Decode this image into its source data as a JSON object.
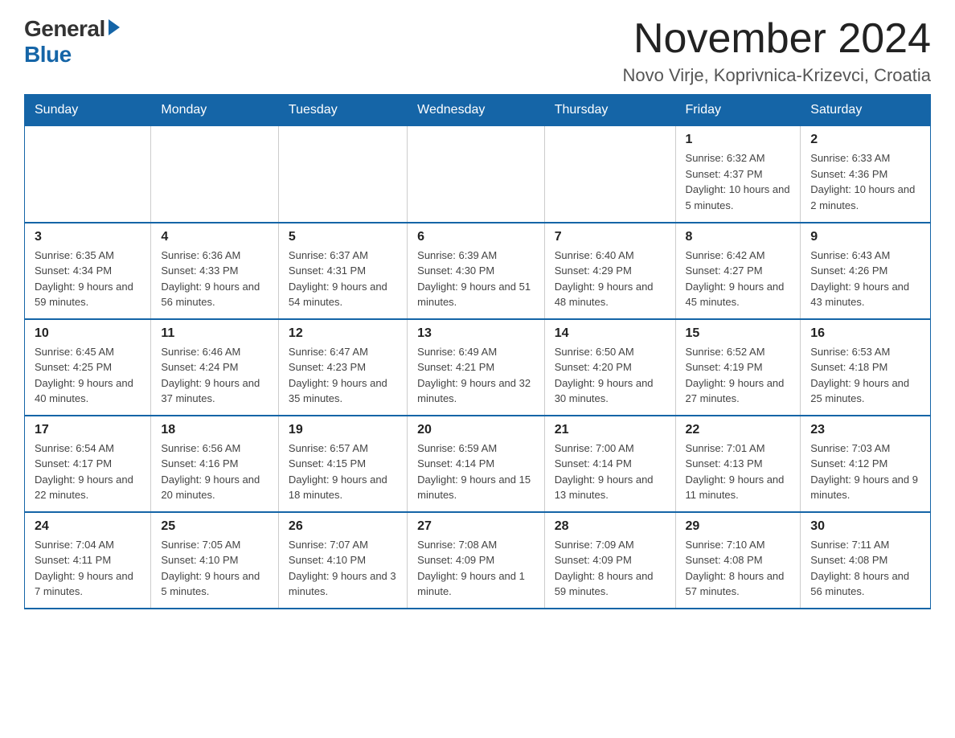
{
  "logo": {
    "general": "General",
    "blue": "Blue"
  },
  "title": "November 2024",
  "subtitle": "Novo Virje, Koprivnica-Krizevci, Croatia",
  "days_of_week": [
    "Sunday",
    "Monday",
    "Tuesday",
    "Wednesday",
    "Thursday",
    "Friday",
    "Saturday"
  ],
  "weeks": [
    [
      {
        "day": "",
        "info": ""
      },
      {
        "day": "",
        "info": ""
      },
      {
        "day": "",
        "info": ""
      },
      {
        "day": "",
        "info": ""
      },
      {
        "day": "",
        "info": ""
      },
      {
        "day": "1",
        "info": "Sunrise: 6:32 AM\nSunset: 4:37 PM\nDaylight: 10 hours and 5 minutes."
      },
      {
        "day": "2",
        "info": "Sunrise: 6:33 AM\nSunset: 4:36 PM\nDaylight: 10 hours and 2 minutes."
      }
    ],
    [
      {
        "day": "3",
        "info": "Sunrise: 6:35 AM\nSunset: 4:34 PM\nDaylight: 9 hours and 59 minutes."
      },
      {
        "day": "4",
        "info": "Sunrise: 6:36 AM\nSunset: 4:33 PM\nDaylight: 9 hours and 56 minutes."
      },
      {
        "day": "5",
        "info": "Sunrise: 6:37 AM\nSunset: 4:31 PM\nDaylight: 9 hours and 54 minutes."
      },
      {
        "day": "6",
        "info": "Sunrise: 6:39 AM\nSunset: 4:30 PM\nDaylight: 9 hours and 51 minutes."
      },
      {
        "day": "7",
        "info": "Sunrise: 6:40 AM\nSunset: 4:29 PM\nDaylight: 9 hours and 48 minutes."
      },
      {
        "day": "8",
        "info": "Sunrise: 6:42 AM\nSunset: 4:27 PM\nDaylight: 9 hours and 45 minutes."
      },
      {
        "day": "9",
        "info": "Sunrise: 6:43 AM\nSunset: 4:26 PM\nDaylight: 9 hours and 43 minutes."
      }
    ],
    [
      {
        "day": "10",
        "info": "Sunrise: 6:45 AM\nSunset: 4:25 PM\nDaylight: 9 hours and 40 minutes."
      },
      {
        "day": "11",
        "info": "Sunrise: 6:46 AM\nSunset: 4:24 PM\nDaylight: 9 hours and 37 minutes."
      },
      {
        "day": "12",
        "info": "Sunrise: 6:47 AM\nSunset: 4:23 PM\nDaylight: 9 hours and 35 minutes."
      },
      {
        "day": "13",
        "info": "Sunrise: 6:49 AM\nSunset: 4:21 PM\nDaylight: 9 hours and 32 minutes."
      },
      {
        "day": "14",
        "info": "Sunrise: 6:50 AM\nSunset: 4:20 PM\nDaylight: 9 hours and 30 minutes."
      },
      {
        "day": "15",
        "info": "Sunrise: 6:52 AM\nSunset: 4:19 PM\nDaylight: 9 hours and 27 minutes."
      },
      {
        "day": "16",
        "info": "Sunrise: 6:53 AM\nSunset: 4:18 PM\nDaylight: 9 hours and 25 minutes."
      }
    ],
    [
      {
        "day": "17",
        "info": "Sunrise: 6:54 AM\nSunset: 4:17 PM\nDaylight: 9 hours and 22 minutes."
      },
      {
        "day": "18",
        "info": "Sunrise: 6:56 AM\nSunset: 4:16 PM\nDaylight: 9 hours and 20 minutes."
      },
      {
        "day": "19",
        "info": "Sunrise: 6:57 AM\nSunset: 4:15 PM\nDaylight: 9 hours and 18 minutes."
      },
      {
        "day": "20",
        "info": "Sunrise: 6:59 AM\nSunset: 4:14 PM\nDaylight: 9 hours and 15 minutes."
      },
      {
        "day": "21",
        "info": "Sunrise: 7:00 AM\nSunset: 4:14 PM\nDaylight: 9 hours and 13 minutes."
      },
      {
        "day": "22",
        "info": "Sunrise: 7:01 AM\nSunset: 4:13 PM\nDaylight: 9 hours and 11 minutes."
      },
      {
        "day": "23",
        "info": "Sunrise: 7:03 AM\nSunset: 4:12 PM\nDaylight: 9 hours and 9 minutes."
      }
    ],
    [
      {
        "day": "24",
        "info": "Sunrise: 7:04 AM\nSunset: 4:11 PM\nDaylight: 9 hours and 7 minutes."
      },
      {
        "day": "25",
        "info": "Sunrise: 7:05 AM\nSunset: 4:10 PM\nDaylight: 9 hours and 5 minutes."
      },
      {
        "day": "26",
        "info": "Sunrise: 7:07 AM\nSunset: 4:10 PM\nDaylight: 9 hours and 3 minutes."
      },
      {
        "day": "27",
        "info": "Sunrise: 7:08 AM\nSunset: 4:09 PM\nDaylight: 9 hours and 1 minute."
      },
      {
        "day": "28",
        "info": "Sunrise: 7:09 AM\nSunset: 4:09 PM\nDaylight: 8 hours and 59 minutes."
      },
      {
        "day": "29",
        "info": "Sunrise: 7:10 AM\nSunset: 4:08 PM\nDaylight: 8 hours and 57 minutes."
      },
      {
        "day": "30",
        "info": "Sunrise: 7:11 AM\nSunset: 4:08 PM\nDaylight: 8 hours and 56 minutes."
      }
    ]
  ]
}
